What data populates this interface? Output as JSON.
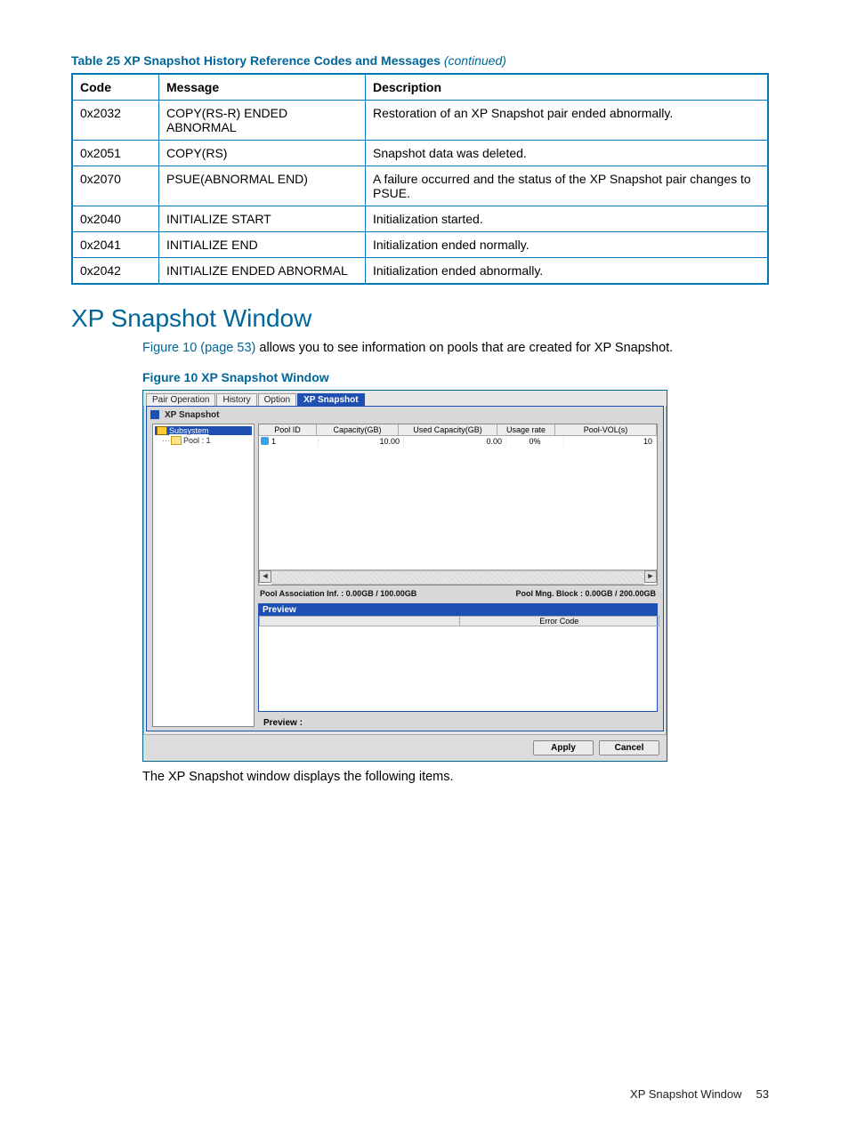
{
  "table": {
    "title_prefix": "Table 25 XP Snapshot History Reference Codes and Messages",
    "title_suffix": "(continued)",
    "headers": {
      "code": "Code",
      "message": "Message",
      "description": "Description"
    },
    "rows": [
      {
        "code": "0x2032",
        "message": "COPY(RS-R) ENDED ABNORMAL",
        "description": "Restoration of an XP Snapshot pair ended abnormally."
      },
      {
        "code": "0x2051",
        "message": "COPY(RS)",
        "description": "Snapshot data was deleted."
      },
      {
        "code": "0x2070",
        "message": "PSUE(ABNORMAL END)",
        "description": "A failure occurred and the status of the XP Snapshot pair changes to PSUE."
      },
      {
        "code": "0x2040",
        "message": "INITIALIZE START",
        "description": "Initialization started."
      },
      {
        "code": "0x2041",
        "message": "INITIALIZE END",
        "description": "Initialization ended normally."
      },
      {
        "code": "0x2042",
        "message": "INITIALIZE ENDED ABNORMAL",
        "description": "Initialization ended abnormally."
      }
    ]
  },
  "section_heading": "XP Snapshot Window",
  "intro_para": {
    "link_text": "Figure 10 (page 53)",
    "rest": " allows you to see information on pools that are created for XP Snapshot."
  },
  "figure_title": "Figure 10 XP Snapshot Window",
  "app": {
    "tabs": {
      "t1": "Pair Operation",
      "t2": "History",
      "t3": "Option",
      "t4": "XP Snapshot"
    },
    "panel_title": "XP Snapshot",
    "tree": {
      "root": "Subsystem",
      "child": "Pool : 1"
    },
    "grid": {
      "headers": {
        "c1": "Pool ID",
        "c2": "Capacity(GB)",
        "c3": "Used Capacity(GB)",
        "c4": "Usage rate",
        "c5": "Pool-VOL(s)"
      },
      "row": {
        "c1": "1",
        "c2": "10.00",
        "c3": "0.00",
        "c4": "0%",
        "c5": "10"
      }
    },
    "info_left": "Pool Association Inf. : 0.00GB / 100.00GB",
    "info_right": "Pool Mng. Block : 0.00GB / 200.00GB",
    "preview_title": "Preview",
    "preview_header": "Error Code",
    "preview_footer": "Preview :",
    "apply_btn": "Apply",
    "cancel_btn": "Cancel"
  },
  "closing_para": "The XP Snapshot window displays the following items.",
  "footer": {
    "title": "XP Snapshot Window",
    "page": "53"
  }
}
